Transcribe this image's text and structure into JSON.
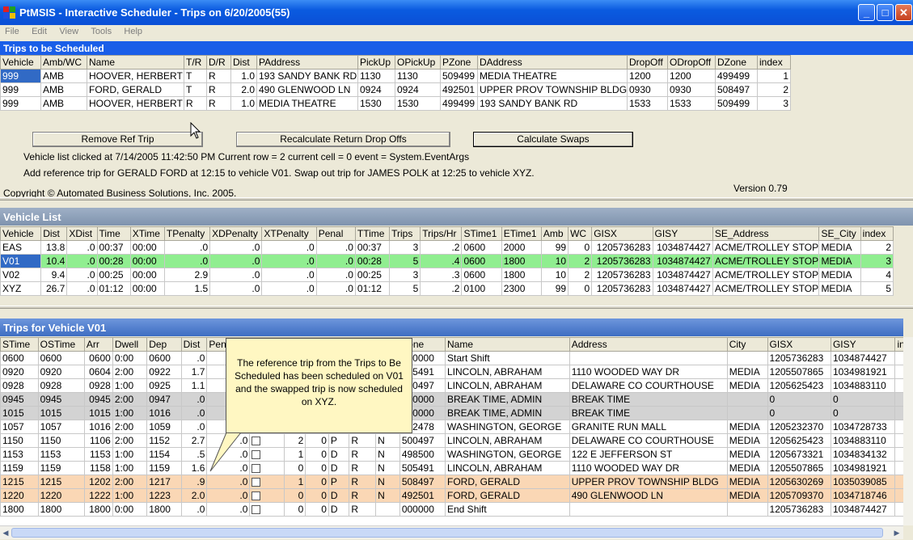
{
  "window": {
    "title": "PtMSIS - Interactive Scheduler - Trips on 6/20/2005(55)",
    "controls": {
      "minimize": "_",
      "maximize": "□",
      "close": "✕"
    }
  },
  "menu": [
    "File",
    "Edit",
    "View",
    "Tools",
    "Help"
  ],
  "trips_to_schedule": {
    "header": "Trips to be Scheduled",
    "columns": [
      "Vehicle",
      "Amb/WC",
      "Name",
      "T/R",
      "D/R",
      "Dist",
      "PAddress",
      "PickUp",
      "OPickUp",
      "PZone",
      "DAddress",
      "DropOff",
      "ODropOff",
      "DZone",
      "index"
    ],
    "rows": [
      [
        "999",
        "AMB",
        "HOOVER, HERBERT",
        "T",
        "R",
        "1.0",
        "193 SANDY BANK RD",
        "1130",
        "1130",
        "509499",
        "MEDIA THEATRE",
        "1200",
        "1200",
        "499499",
        "1"
      ],
      [
        "999",
        "AMB",
        "FORD, GERALD",
        "T",
        "R",
        "2.0",
        "490 GLENWOOD LN",
        "0924",
        "0924",
        "492501",
        "UPPER PROV TOWNSHIP BLDG",
        "0930",
        "0930",
        "508497",
        "2"
      ],
      [
        "999",
        "AMB",
        "HOOVER, HERBERT",
        "R",
        "R",
        "1.0",
        "MEDIA THEATRE",
        "1530",
        "1530",
        "499499",
        "193 SANDY BANK RD",
        "1533",
        "1533",
        "509499",
        "3"
      ]
    ]
  },
  "actions": {
    "remove_ref_trip": "Remove Ref Trip",
    "recalculate": "Recalculate Return Drop Offs",
    "calculate_swaps": "Calculate Swaps"
  },
  "status": {
    "line1": "Vehicle list clicked at 7/14/2005 11:42:50 PM Current row = 2 current cell = 0 event = System.EventArgs",
    "line2": "Add reference trip for GERALD FORD at 12:15 to vehicle V01.  Swap out trip for JAMES POLK at 12:25 to vehicle XYZ.",
    "copyright": "Copyright © Automated Business Solutions, Inc. 2005.",
    "version": "Version 0.79"
  },
  "vehicle_list": {
    "header": "Vehicle List",
    "columns": [
      "Vehicle",
      "Dist",
      "XDist",
      "Time",
      "XTime",
      "TPenalty",
      "XDPenalty",
      "XTPenalty",
      "Penal",
      "TTime",
      "Trips",
      "Trips/Hr",
      "STime1",
      "ETime1",
      "Amb",
      "WC",
      "GISX",
      "GISY",
      "SE_Address",
      "SE_City",
      "index"
    ],
    "rows": [
      [
        "EAS",
        "13.8",
        ".0",
        "00:37",
        "00:00",
        ".0",
        ".0",
        ".0",
        ".0",
        "00:37",
        "3",
        ".2",
        "0600",
        "2000",
        "99",
        "0",
        "1205736283",
        "1034874427",
        "ACME/TROLLEY STOP",
        "MEDIA",
        "2"
      ],
      [
        "V01",
        "10.4",
        ".0",
        "00:28",
        "00:00",
        ".0",
        ".0",
        ".0",
        ".0",
        "00:28",
        "5",
        ".4",
        "0600",
        "1800",
        "10",
        "2",
        "1205736283",
        "1034874427",
        "ACME/TROLLEY STOP",
        "MEDIA",
        "3"
      ],
      [
        "V02",
        "9.4",
        ".0",
        "00:25",
        "00:00",
        "2.9",
        ".0",
        ".0",
        ".0",
        "00:25",
        "3",
        ".3",
        "0600",
        "1800",
        "10",
        "2",
        "1205736283",
        "1034874427",
        "ACME/TROLLEY STOP",
        "MEDIA",
        "4"
      ],
      [
        "XYZ",
        "26.7",
        ".0",
        "01:12",
        "00:00",
        "1.5",
        ".0",
        ".0",
        ".0",
        "01:12",
        "5",
        ".2",
        "0100",
        "2300",
        "99",
        "0",
        "1205736283",
        "1034874427",
        "ACME/TROLLEY STOP",
        "MEDIA",
        "5"
      ]
    ]
  },
  "vehicle_trips": {
    "header": "Trips for Vehicle V01",
    "columns": [
      "STime",
      "OSTime",
      "Arr",
      "Dwell",
      "Dep",
      "Dist",
      "Penalty",
      "",
      "",
      "",
      "",
      "",
      "",
      "Zone",
      "Name",
      "Address",
      "City",
      "GISX",
      "GISY",
      "index"
    ],
    "rows": [
      [
        "0600",
        "0600",
        "0600",
        "0:00",
        "0600",
        ".0",
        "",
        "",
        "",
        "",
        "",
        "",
        "",
        "000000",
        "Start Shift",
        "",
        "",
        "1205736283",
        "1034874427",
        ""
      ],
      [
        "0920",
        "0920",
        "0604",
        "2:00",
        "0922",
        "1.7",
        "",
        "",
        "",
        "",
        "",
        "",
        "",
        "505491",
        "LINCOLN, ABRAHAM",
        "1110 WOODED WAY DR",
        "MEDIA",
        "1205507865",
        "1034981921",
        ""
      ],
      [
        "0928",
        "0928",
        "0928",
        "1:00",
        "0925",
        "1.1",
        "",
        "",
        "",
        "",
        "",
        "",
        "",
        "500497",
        "LINCOLN, ABRAHAM",
        "DELAWARE CO COURTHOUSE",
        "MEDIA",
        "1205625423",
        "1034883110",
        ""
      ],
      [
        "0945",
        "0945",
        "0945",
        "2:00",
        "0947",
        ".0",
        "",
        "",
        "",
        "",
        "",
        "",
        "",
        "000000",
        "BREAK TIME, ADMIN",
        "BREAK TIME",
        "",
        "0",
        "0",
        ""
      ],
      [
        "1015",
        "1015",
        "1015",
        "1:00",
        "1016",
        ".0",
        "",
        "",
        "",
        "",
        "",
        "",
        "",
        "000000",
        "BREAK TIME, ADMIN",
        "BREAK TIME",
        "",
        "0",
        "0",
        ""
      ],
      [
        "1057",
        "1057",
        "1016",
        "2:00",
        "1059",
        ".0",
        "",
        "",
        "",
        "",
        "",
        "",
        "",
        "492478",
        "WASHINGTON, GEORGE",
        "GRANITE RUN MALL",
        "MEDIA",
        "1205232370",
        "1034728733",
        ""
      ],
      [
        "1150",
        "1150",
        "1106",
        "2:00",
        "1152",
        "2.7",
        ".0",
        "",
        "2",
        "0",
        "P",
        "R",
        "N",
        "500497",
        "LINCOLN, ABRAHAM",
        "DELAWARE CO COURTHOUSE",
        "MEDIA",
        "1205625423",
        "1034883110",
        ""
      ],
      [
        "1153",
        "1153",
        "1153",
        "1:00",
        "1154",
        ".5",
        ".0",
        "",
        "1",
        "0",
        "D",
        "R",
        "N",
        "498500",
        "WASHINGTON, GEORGE",
        "122 E JEFFERSON ST",
        "MEDIA",
        "1205673321",
        "1034834132",
        ""
      ],
      [
        "1159",
        "1159",
        "1158",
        "1:00",
        "1159",
        "1.6",
        ".0",
        "",
        "0",
        "0",
        "D",
        "R",
        "N",
        "505491",
        "LINCOLN, ABRAHAM",
        "1110 WOODED WAY DR",
        "MEDIA",
        "1205507865",
        "1034981921",
        ""
      ],
      [
        "1215",
        "1215",
        "1202",
        "2:00",
        "1217",
        ".9",
        ".0",
        "",
        "1",
        "0",
        "P",
        "R",
        "N",
        "508497",
        "FORD, GERALD",
        "UPPER PROV TOWNSHIP BLDG",
        "MEDIA",
        "1205630269",
        "1035039085",
        ""
      ],
      [
        "1220",
        "1220",
        "1222",
        "1:00",
        "1223",
        "2.0",
        ".0",
        "",
        "0",
        "0",
        "D",
        "R",
        "N",
        "492501",
        "FORD, GERALD",
        "490 GLENWOOD LN",
        "MEDIA",
        "1205709370",
        "1034718746",
        ""
      ],
      [
        "1800",
        "1800",
        "1800",
        "0:00",
        "1800",
        ".0",
        ".0",
        "",
        "0",
        "0",
        "D",
        "R",
        "",
        "000000",
        "End Shift",
        "",
        "",
        "1205736283",
        "1034874427",
        ""
      ]
    ],
    "trailing_r": [
      "",
      "",
      "",
      "",
      "",
      "",
      "R",
      "R",
      "R",
      "R",
      "R",
      "R"
    ]
  },
  "callout": {
    "text": "The reference trip from the Trips to Be Scheduled has been scheduled on V01 and the swapped trip is now scheduled on XYZ."
  },
  "colors": {
    "selected_row": "#90ee90",
    "break_row": "#d3d3d3",
    "ref_trip_row": "#fad7b5",
    "header_blue": "#1a5ee8"
  }
}
